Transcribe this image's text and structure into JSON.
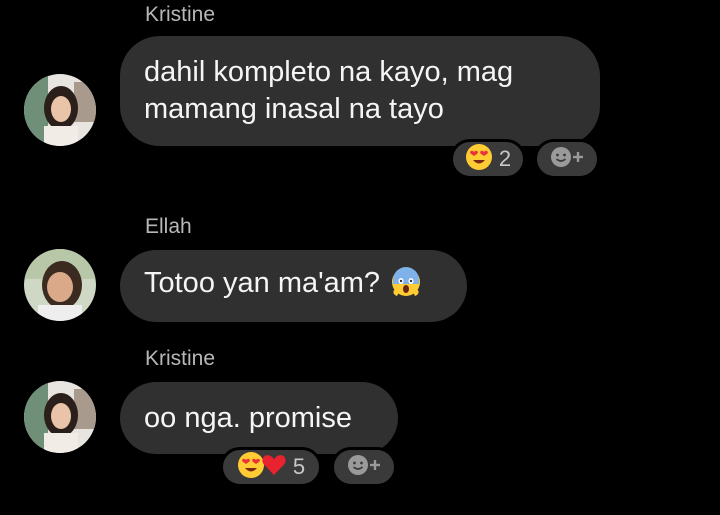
{
  "messages": [
    {
      "sender": "Kristine",
      "avatar": "avatar-kristine",
      "lines": [
        "dahil kompleto na kayo, mag",
        "mamang inasal na tayo"
      ],
      "reactions": {
        "emojis": [
          "heart-eyes-emoji"
        ],
        "count": "2"
      },
      "add_reaction_icon": "add-reaction-icon"
    },
    {
      "sender": "Ellah",
      "avatar": "avatar-ellah",
      "text": "Totoo yan ma'am?",
      "inline_emoji": "screaming-face-emoji"
    },
    {
      "sender": "Kristine",
      "avatar": "avatar-kristine",
      "text": "oo nga. promise",
      "reactions": {
        "emojis": [
          "heart-eyes-emoji",
          "red-heart-emoji"
        ],
        "count": "5"
      },
      "add_reaction_icon": "add-reaction-icon"
    }
  ],
  "colors": {
    "background": "#000000",
    "bubble": "#303030",
    "sender_name": "#b7b7b7",
    "reaction_pill": "#3a3a3a"
  }
}
